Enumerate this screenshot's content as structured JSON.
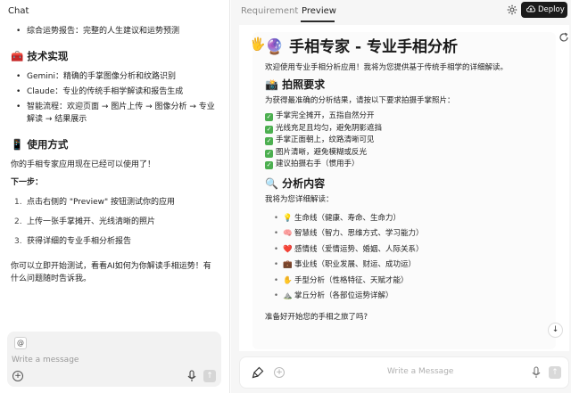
{
  "chat": {
    "title": "Chat",
    "intro_bullet": "综合运势报告：完整的人生建议和运势预测",
    "tech_heading": "🧰 技术实现",
    "tech_items": [
      "Gemini：精确的手掌图像分析和纹路识别",
      "Claude：专业的传统手相学解读和报告生成",
      "智能流程：欢迎页面 → 图片上传 → 图像分析 → 专业解读 → 结果展示"
    ],
    "usage_heading": "📱 使用方式",
    "usage_text": "你的手相专家应用现在已经可以使用了！",
    "next_label": "下一步：",
    "steps": [
      "点击右侧的 \"Preview\" 按钮测试你的应用",
      "上传一张手掌摊开、光线清晰的照片",
      "获得详细的专业手相分析报告"
    ],
    "closing": "你可以立即开始测试，看看AI如何为你解读手相运势！有什么问题随时告诉我。",
    "composer": {
      "at": "@",
      "placeholder": "Write a message"
    }
  },
  "preview_panel": {
    "tabs": [
      "Requirement",
      "Preview"
    ],
    "active_tab": "Preview",
    "deploy_label": "Deploy",
    "page": {
      "title": "🔮 手相专家 - 专业手相分析",
      "intro": "欢迎使用专业手相分析应用！我将为您提供基于传统手相学的详细解读。",
      "photo_heading": "📸 拍照要求",
      "photo_intro": "为获得最准确的分析结果，请按以下要求拍摄手掌照片：",
      "requirements": [
        "手掌完全摊开，五指自然分开",
        "光线充足且均匀，避免阴影遮挡",
        "手掌正面朝上，纹路清晰可见",
        "图片清晰，避免模糊或反光",
        "建议拍摄右手（惯用手）"
      ],
      "analysis_heading": "🔍 分析内容",
      "analysis_intro": "我将为您详细解读：",
      "analysis_items": [
        {
          "icon": "💡",
          "text": "生命线（健康、寿命、生命力）"
        },
        {
          "icon": "🧠",
          "text": "智慧线（智力、思维方式、学习能力）"
        },
        {
          "icon": "❤️",
          "text": "感情线（爱情运势、婚姻、人际关系）"
        },
        {
          "icon": "💼",
          "text": "事业线（职业发展、财运、成功运）"
        },
        {
          "icon": "✋",
          "text": "手型分析（性格特征、天赋才能）"
        },
        {
          "icon": "⛰️",
          "text": "掌丘分析（各部位运势详解）"
        }
      ],
      "ready": "准备好开始您的手相之旅了吗?"
    },
    "input_placeholder": "Write a Message"
  }
}
